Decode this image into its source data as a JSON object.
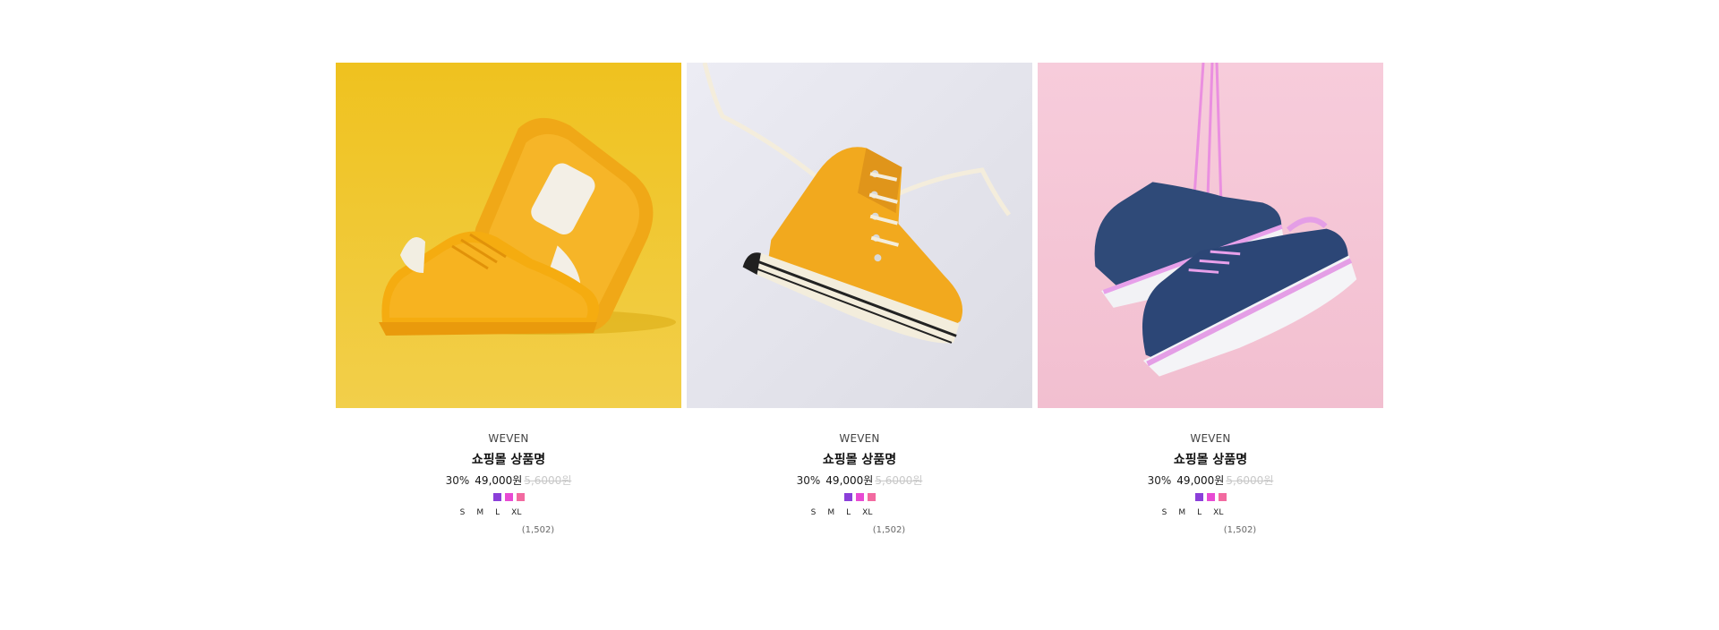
{
  "products": [
    {
      "brand": "WEVEN",
      "name": "쇼핑몰 상품명",
      "discount": "30%",
      "price": "49,000원",
      "original_price": "5,6000원",
      "swatches": [
        "#8b3fd9",
        "#e84ad3",
        "#f26aa0"
      ],
      "sizes": [
        "S",
        "M",
        "L",
        "XL"
      ],
      "reviews": "(1,502)",
      "image": "yellow-sneakers",
      "bg_color": "#f0c426"
    },
    {
      "brand": "WEVEN",
      "name": "쇼핑몰 상품명",
      "discount": "30%",
      "price": "49,000원",
      "original_price": "5,6000원",
      "swatches": [
        "#8b3fd9",
        "#e84ad3",
        "#f26aa0"
      ],
      "sizes": [
        "S",
        "M",
        "L",
        "XL"
      ],
      "reviews": "(1,502)",
      "image": "orange-high-top-sneaker",
      "bg_color": "#e8e8ef"
    },
    {
      "brand": "WEVEN",
      "name": "쇼핑몰 상품명",
      "discount": "30%",
      "price": "49,000원",
      "original_price": "5,6000원",
      "swatches": [
        "#8b3fd9",
        "#e84ad3",
        "#f26aa0"
      ],
      "sizes": [
        "S",
        "M",
        "L",
        "XL"
      ],
      "reviews": "(1,502)",
      "image": "navy-running-shoes",
      "bg_color": "#f5c8d8"
    }
  ]
}
